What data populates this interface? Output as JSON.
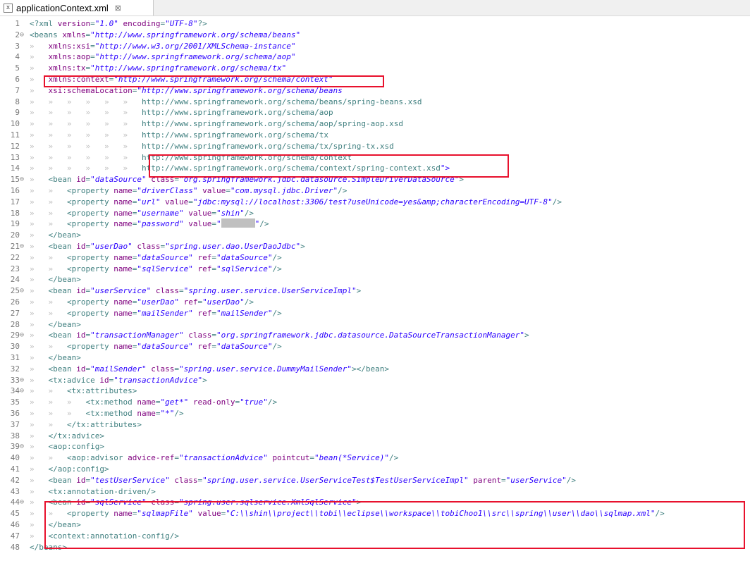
{
  "tab": {
    "title": "applicationContext.xml",
    "icon": "x",
    "close_glyph": "⊠"
  },
  "line_numbers": [
    "1",
    "2",
    "3",
    "4",
    "5",
    "6",
    "7",
    "8",
    "9",
    "10",
    "11",
    "12",
    "13",
    "14",
    "15",
    "16",
    "17",
    "18",
    "19",
    "20",
    "21",
    "22",
    "23",
    "24",
    "25",
    "26",
    "27",
    "28",
    "29",
    "30",
    "31",
    "32",
    "33",
    "34",
    "35",
    "36",
    "37",
    "38",
    "39",
    "40",
    "41",
    "42",
    "43",
    "44",
    "45",
    "46",
    "47",
    "48"
  ],
  "folds": {
    "2": "⊖",
    "15": "⊖",
    "21": "⊖",
    "25": "⊖",
    "29": "⊖",
    "33": "⊖",
    "34": "⊖",
    "39": "⊖",
    "44": "⊖"
  },
  "code_lines": [
    "<?xml version=\"1.0\" encoding=\"UTF-8\"?>",
    "<beans xmlns=\"http://www.springframework.org/schema/beans\"",
    "    xmlns:xsi=\"http://www.w3.org/2001/XMLSchema-instance\"",
    "    xmlns:aop=\"http://www.springframework.org/schema/aop\"",
    "    xmlns:tx=\"http://www.springframework.org/schema/tx\"",
    "    xmlns:context=\"http://www.springframework.org/schema/context\"",
    "    xsi:schemaLocation=\"http://www.springframework.org/schema/beans",
    "                        http://www.springframework.org/schema/beans/spring-beans.xsd",
    "                        http://www.springframework.org/schema/aop",
    "                        http://www.springframework.org/schema/aop/spring-aop.xsd",
    "                        http://www.springframework.org/schema/tx",
    "                        http://www.springframework.org/schema/tx/spring-tx.xsd",
    "                        http://www.springframework.org/schema/context",
    "                        http://www.springframework.org/schema/context/spring-context.xsd\">",
    "    <bean id=\"dataSource\" class=\"org.springframework.jdbc.datasource.SimpleDriverDataSource\">",
    "        <property name=\"driverClass\" value=\"com.mysql.jdbc.Driver\"/>",
    "        <property name=\"url\" value=\"jdbc:mysql://localhost:3306/test?useUnicode=yes&amp;characterEncoding=UTF-8\"/>",
    "        <property name=\"username\" value=\"shin\"/>",
    "        <property name=\"password\" value=\"",
    "    </bean>",
    "    <bean id=\"userDao\" class=\"spring.user.dao.UserDaoJdbc\">",
    "        <property name=\"dataSource\" ref=\"dataSource\"/>",
    "        <property name=\"sqlService\" ref=\"sqlService\"/>",
    "    </bean>",
    "    <bean id=\"userService\" class=\"spring.user.service.UserServiceImpl\">",
    "        <property name=\"userDao\" ref=\"userDao\"/>",
    "        <property name=\"mailSender\" ref=\"mailSender\"/>",
    "    </bean>",
    "    <bean id=\"transactionManager\" class=\"org.springframework.jdbc.datasource.DataSourceTransactionManager\">",
    "        <property name=\"dataSource\" ref=\"dataSource\"/>",
    "    </bean>",
    "    <bean id=\"mailSender\" class=\"spring.user.service.DummyMailSender\"></bean>",
    "    <tx:advice id=\"transactionAdvice\">",
    "        <tx:attributes>",
    "            <tx:method name=\"get*\" read-only=\"true\"/>",
    "            <tx:method name=\"*\"/>",
    "        </tx:attributes>",
    "    </tx:advice>",
    "    <aop:config>",
    "        <aop:advisor advice-ref=\"transactionAdvice\" pointcut=\"bean(*Service)\"/>",
    "    </aop:config>",
    "    <bean id=\"testUserService\" class=\"spring.user.service.UserServiceTest$TestUserServiceImpl\" parent=\"userService\"/>",
    "    <tx:annotation-driven/>",
    "    <bean id=\"sqlService\" class=\"spring.user.sqlservice.XmlSqlService\">",
    "        <property name=\"sqlmapFile\" value=\"C:\\\\shin\\\\project\\\\tobi\\\\eclipse\\\\workspace\\\\tobiChoo1\\\\src\\\\spring\\\\user\\\\dao\\\\sqlmap.xml\"/>",
    "    </bean>",
    "    <context:annotation-config/>",
    "</beans>"
  ],
  "password_tail": "\"/>",
  "colors": {
    "tag": "#3f7f7f",
    "attribute": "#7f007f",
    "string": "#2a00ff",
    "line_number": "#787878",
    "highlight_box": "#e8112d"
  }
}
